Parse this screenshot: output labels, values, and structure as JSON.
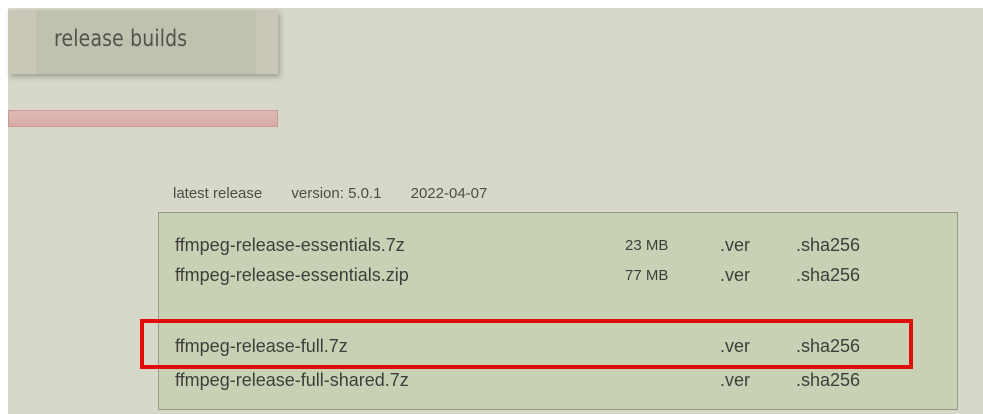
{
  "section": {
    "title": "release builds"
  },
  "release_info": {
    "label": "latest release",
    "version": "version: 5.0.1",
    "date": "2022-04-07"
  },
  "downloads": {
    "items": [
      {
        "name": "ffmpeg-release-essentials.7z",
        "size": "23 MB",
        "ver": ".ver",
        "sha": ".sha256"
      },
      {
        "name": "ffmpeg-release-essentials.zip",
        "size": "77 MB",
        "ver": ".ver",
        "sha": ".sha256"
      },
      {
        "name": "ffmpeg-release-full.7z",
        "size": "",
        "ver": ".ver",
        "sha": ".sha256"
      },
      {
        "name": "ffmpeg-release-full-shared.7z",
        "size": "",
        "ver": ".ver",
        "sha": ".sha256"
      }
    ]
  },
  "colors": {
    "background": "#d7d8ca",
    "panel": "#c8d1b4",
    "highlight": "#e10d0d",
    "progress": "#d8b0aa"
  },
  "highlight": {
    "target": "ffmpeg-release-full.7z"
  }
}
